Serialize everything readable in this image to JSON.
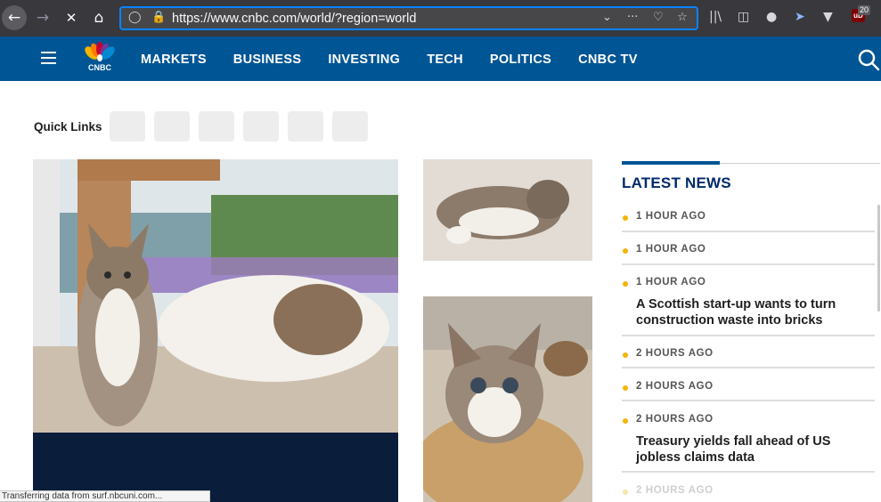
{
  "browser": {
    "url": "https://www.cnbc.com/world/?region=world",
    "icons": [
      "back-arrow-icon",
      "forward-arrow-icon",
      "stop-loading-icon",
      "home-icon",
      "shield-icon",
      "lock-icon",
      "chevron-down-icon",
      "more-icon",
      "pocket-icon",
      "star-icon",
      "library-icon",
      "sidebar-icon",
      "account-icon",
      "cursor-extension-icon",
      "vpn-extension-icon",
      "ublock-icon"
    ],
    "ublock_label": "uD",
    "ublock_count": "20"
  },
  "nav": {
    "logo_text": "CNBC",
    "items": [
      {
        "label": "MARKETS"
      },
      {
        "label": "BUSINESS"
      },
      {
        "label": "INVESTING"
      },
      {
        "label": "TECH"
      },
      {
        "label": "POLITICS"
      },
      {
        "label": "CNBC TV"
      }
    ]
  },
  "quick_links": {
    "label": "Quick Links",
    "count": 6
  },
  "latest_news": {
    "title": "LATEST NEWS",
    "items": [
      {
        "time": "1 HOUR AGO",
        "headline": ""
      },
      {
        "time": "1 HOUR AGO",
        "headline": ""
      },
      {
        "time": "1 HOUR AGO",
        "headline": "A Scottish start-up wants to turn construction waste into bricks"
      },
      {
        "time": "2 HOURS AGO",
        "headline": ""
      },
      {
        "time": "2 HOURS AGO",
        "headline": ""
      },
      {
        "time": "2 HOURS AGO",
        "headline": "Treasury yields fall ahead of US jobless claims data"
      },
      {
        "time": "2 HOURS AGO",
        "headline": ""
      }
    ]
  },
  "status_bar": {
    "text": "Transferring data from surf.nbcuni.com..."
  },
  "colors": {
    "nav_bg": "#005594",
    "accent_dot": "#f4b400",
    "news_title": "#002a6b",
    "hero_caption_bg": "#0a1d3a"
  }
}
